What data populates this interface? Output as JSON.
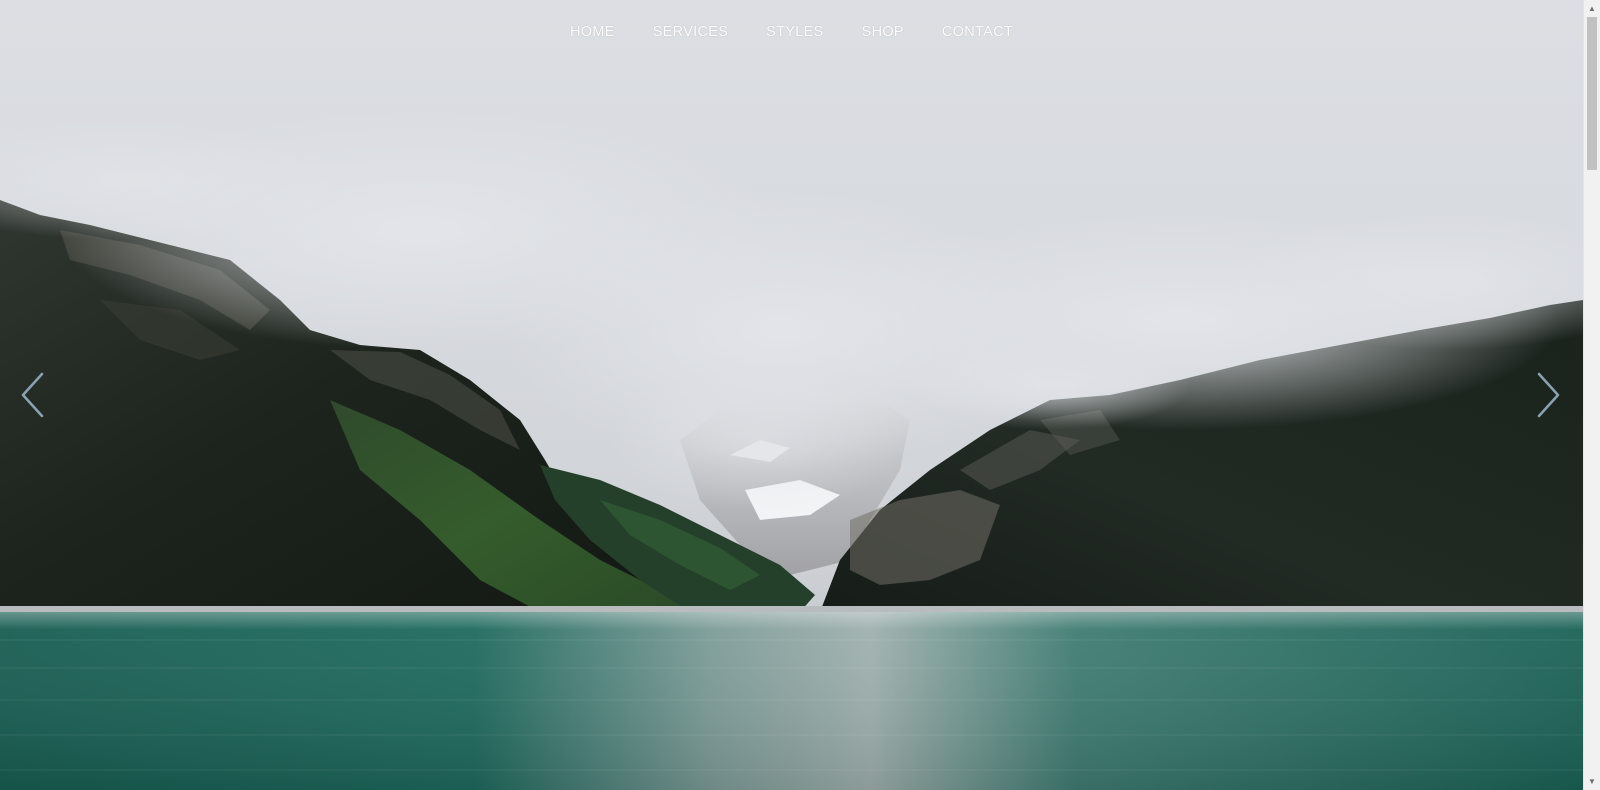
{
  "nav": {
    "items": [
      {
        "label": "HOME"
      },
      {
        "label": "SERVICES"
      },
      {
        "label": "STYLES"
      },
      {
        "label": "SHOP"
      },
      {
        "label": "CONTACT"
      }
    ]
  },
  "slider": {
    "prev_icon": "chevron-left-icon",
    "next_icon": "chevron-right-icon",
    "image": "misty mountain lake landscape"
  },
  "scrollbar": {
    "up_icon": "triangle-up",
    "down_icon": "triangle-down"
  },
  "colors": {
    "nav_text": "#ffffff",
    "lake": "#1f6b5e",
    "fog": "#dfe1e6",
    "forest": "#151c17",
    "scroll_track": "#f1f1f1",
    "scroll_thumb": "#c1c1c1"
  }
}
